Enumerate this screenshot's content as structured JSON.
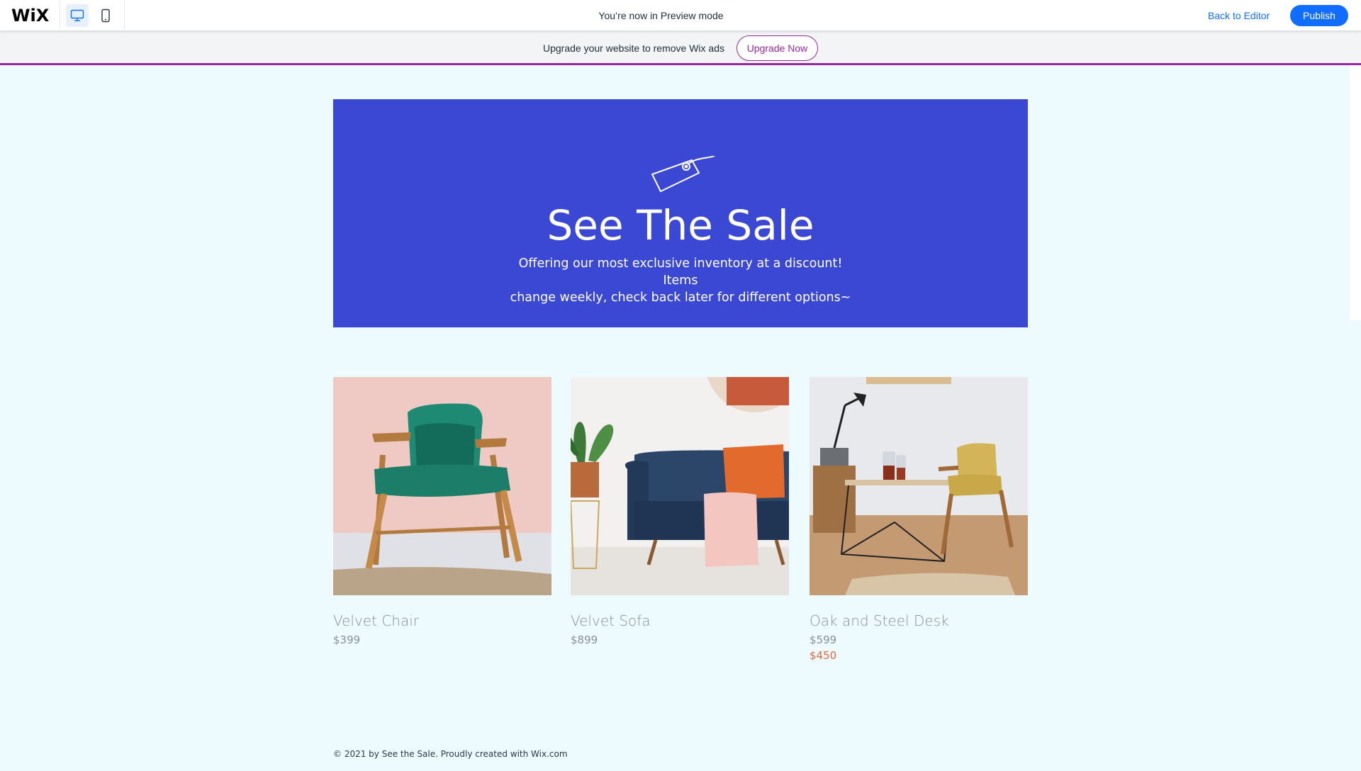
{
  "topbar": {
    "logo": "WiX",
    "preview_text": "You’re now in Preview mode",
    "back_to_editor": "Back to Editor",
    "publish": "Publish",
    "device_icons": [
      "desktop-icon",
      "mobile-icon"
    ]
  },
  "upgrade_bar": {
    "text": "Upgrade your website to remove Wix ads",
    "button": "Upgrade Now"
  },
  "hero": {
    "icon": "price-tag-icon",
    "title": "See The Sale",
    "subtitle_line1": "Offering our most exclusive inventory at a discount! Items",
    "subtitle_line2": "change weekly, check back later for different options~"
  },
  "products": [
    {
      "name": "Velvet Chair",
      "price": "$399",
      "sale_price": ""
    },
    {
      "name": "Velvet Sofa",
      "price": "$899",
      "sale_price": ""
    },
    {
      "name": "Oak and Steel Desk",
      "price": "$599",
      "sale_price": "$450"
    }
  ],
  "footer": {
    "text": "© 2021 by See the Sale. Proudly created with Wix.com"
  },
  "colors": {
    "hero_bg": "#3a48d4",
    "site_bg": "#eefbfe",
    "accent_blue": "#116dff",
    "upgrade_purple": "#9a27a1",
    "sale_orange": "#e0683e"
  }
}
